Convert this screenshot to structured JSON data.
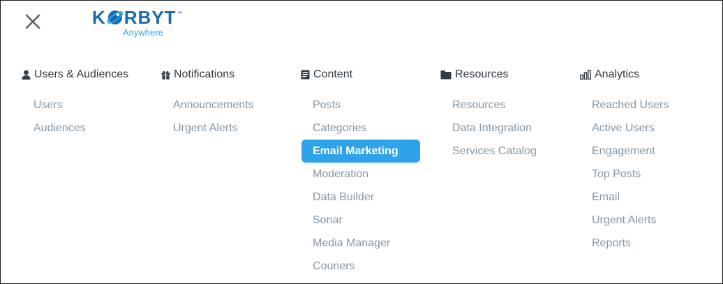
{
  "header": {
    "close_icon": "close-icon",
    "logo": {
      "word": "KORBYT",
      "subtitle": "Anywhere",
      "tm": "™",
      "color": "#1a6bb5",
      "subtitle_color": "#2ea3dc"
    }
  },
  "accent": "#2ea3ea",
  "columns": [
    {
      "icon": "user-icon",
      "title": "Users & Audiences",
      "items": [
        "Users",
        "Audiences"
      ]
    },
    {
      "icon": "gift-icon",
      "title": "Notifications",
      "items": [
        "Announcements",
        "Urgent Alerts"
      ]
    },
    {
      "icon": "document-icon",
      "title": "Content",
      "items": [
        "Posts",
        "Categories",
        "Email Marketing",
        "Moderation",
        "Data Builder",
        "Sonar",
        "Media Manager",
        "Couriers"
      ],
      "selected": "Email Marketing"
    },
    {
      "icon": "folder-icon",
      "title": "Resources",
      "items": [
        "Resources",
        "Data Integration",
        "Services Catalog"
      ]
    },
    {
      "icon": "bar-chart-icon",
      "title": "Analytics",
      "items": [
        "Reached Users",
        "Active Users",
        "Engagement",
        "Top Posts",
        "Email",
        "Urgent Alerts",
        "Reports"
      ]
    }
  ]
}
